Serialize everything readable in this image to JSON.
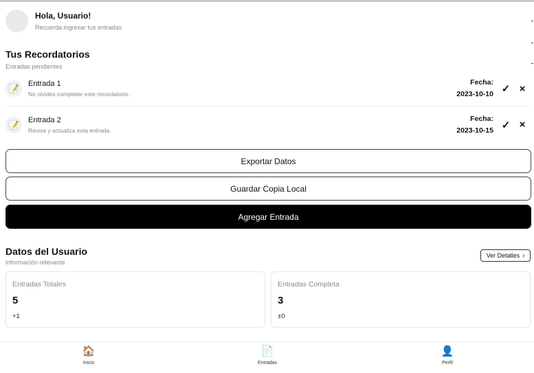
{
  "header": {
    "greeting": "Hola, Usuario!",
    "subtitle": "Recuerda ingresar tus entradas"
  },
  "reminders": {
    "title": "Tus Recordatorios",
    "subtitle": "Entradas pendientes",
    "date_label": "Fecha:",
    "items": [
      {
        "title": "Entrada 1",
        "description": "No olvides completar este recordatorio.",
        "date": "2023-10-10",
        "icon": "pencil-memo-icon"
      },
      {
        "title": "Entrada 2",
        "description": "Revisa y actualiza esta entrada.",
        "date": "2023-10-15",
        "icon": "pencil-memo-icon"
      }
    ],
    "confirm_glyph": "✓",
    "dismiss_glyph": "×"
  },
  "actions": {
    "export_label": "Exportar Datos",
    "backup_label": "Guardar Copia Local",
    "add_label": "Agregar Entrada"
  },
  "user_data": {
    "title": "Datos del Usuario",
    "subtitle": "Información relevante",
    "details_label": "Ver Detalles",
    "stats": [
      {
        "label": "Entradas Totales",
        "value": "5",
        "delta": "+1"
      },
      {
        "label": "Entradas Completa",
        "value": "3",
        "delta": "±0"
      }
    ]
  },
  "nav": {
    "items": [
      {
        "label": "Inicio",
        "icon": "home-icon"
      },
      {
        "label": "Entradas",
        "icon": "document-icon"
      },
      {
        "label": "Perfil",
        "icon": "user-icon"
      }
    ]
  },
  "colors": {
    "primary_button": "#000000",
    "accent_profile": "#3b6fb6"
  }
}
